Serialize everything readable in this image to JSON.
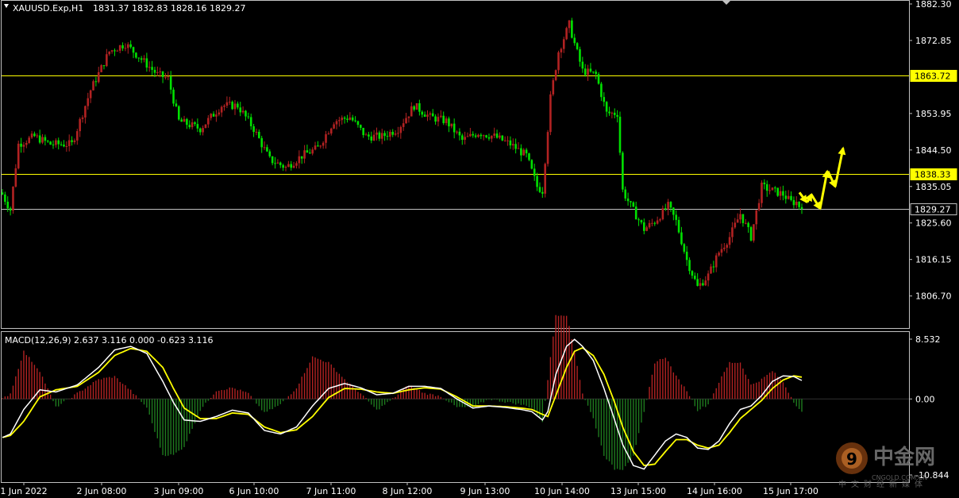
{
  "chart_data": [
    {
      "type": "candlestick",
      "symbol_header": "XAUUSD.Exp,H1",
      "ohlc_header": "1831.37 1832.83 1828.16 1829.27",
      "ylim": [
        1801.9,
        1882.3
      ],
      "y_ticks": [
        "1882.30",
        "1872.85",
        "1853.95",
        "1844.50",
        "1835.05",
        "1825.60",
        "1816.15",
        "1806.70"
      ],
      "x_ticks": [
        "1 Jun 2022",
        "2 Jun 08:00",
        "3 Jun 09:00",
        "6 Jun 10:00",
        "7 Jun 11:00",
        "8 Jun 12:00",
        "9 Jun 13:00",
        "10 Jun 14:00",
        "13 Jun 15:00",
        "14 Jun 16:00",
        "15 Jun 17:00"
      ],
      "bullish_color": "#b22222",
      "bearish_color": "#00e000",
      "horizontal_levels": [
        {
          "value": 1863.72,
          "label": "1863.72",
          "color": "#ffff00"
        },
        {
          "value": 1838.33,
          "label": "1838.33",
          "color": "#ffff00"
        },
        {
          "value": 1829.27,
          "label": "1829.27",
          "color": "#c0c0c0"
        }
      ],
      "price_path": [
        [
          0,
          1833
        ],
        [
          3,
          1829
        ],
        [
          6,
          1846
        ],
        [
          12,
          1848
        ],
        [
          18,
          1846
        ],
        [
          26,
          1846
        ],
        [
          33,
          1860
        ],
        [
          40,
          1870
        ],
        [
          46,
          1872
        ],
        [
          52,
          1868
        ],
        [
          58,
          1864
        ],
        [
          62,
          1863
        ],
        [
          66,
          1852
        ],
        [
          74,
          1850
        ],
        [
          82,
          1856
        ],
        [
          88,
          1856
        ],
        [
          94,
          1850
        ],
        [
          100,
          1842
        ],
        [
          106,
          1840
        ],
        [
          112,
          1843
        ],
        [
          118,
          1845
        ],
        [
          124,
          1852
        ],
        [
          130,
          1853
        ],
        [
          136,
          1848
        ],
        [
          142,
          1848
        ],
        [
          148,
          1850
        ],
        [
          154,
          1856
        ],
        [
          160,
          1853
        ],
        [
          166,
          1852
        ],
        [
          172,
          1847
        ],
        [
          178,
          1849
        ],
        [
          184,
          1848
        ],
        [
          190,
          1846
        ],
        [
          196,
          1843
        ],
        [
          200,
          1835
        ],
        [
          202,
          1834
        ],
        [
          205,
          1858
        ],
        [
          208,
          1870
        ],
        [
          212,
          1877
        ],
        [
          214,
          1872
        ],
        [
          217,
          1865
        ],
        [
          222,
          1864
        ],
        [
          226,
          1854
        ],
        [
          230,
          1854
        ],
        [
          232,
          1834
        ],
        [
          235,
          1830
        ],
        [
          240,
          1824
        ],
        [
          244,
          1826
        ],
        [
          249,
          1830
        ],
        [
          252,
          1826
        ],
        [
          256,
          1816
        ],
        [
          260,
          1809
        ],
        [
          264,
          1812
        ],
        [
          268,
          1818
        ],
        [
          272,
          1822
        ],
        [
          276,
          1828
        ],
        [
          280,
          1822
        ],
        [
          284,
          1835
        ],
        [
          288,
          1834
        ],
        [
          292,
          1833
        ],
        [
          295,
          1831
        ],
        [
          297,
          1831
        ],
        [
          299,
          1829
        ]
      ],
      "projection_arrows": [
        {
          "from": [
            1007,
            1833.5
          ],
          "to": [
            1016,
            1831.0
          ]
        },
        {
          "from": [
            1017,
            1831.0
          ],
          "to": [
            1022,
            1833.0
          ]
        },
        {
          "from": [
            1022,
            1833.0
          ],
          "to": [
            1033,
            1829.3
          ]
        },
        {
          "from": [
            1033,
            1829.3
          ],
          "to": [
            1042,
            1839.0
          ]
        },
        {
          "from": [
            1043,
            1839.0
          ],
          "to": [
            1052,
            1835.0
          ]
        },
        {
          "from": [
            1052,
            1835.0
          ],
          "to": [
            1062,
            1845.0
          ]
        }
      ],
      "arrow_color": "#ffff00"
    },
    {
      "type": "macd",
      "header": "MACD(12,26,9) 2.637 3.116 0.000 -0.623 3.116",
      "ylim": [
        -10.844,
        8.532
      ],
      "y_ticks": [
        "8.532",
        "0.00",
        "-10.844"
      ],
      "macd_color": "#ffffff",
      "signal_color": "#ffff00",
      "hist_pos_color": "#b22222",
      "hist_neg_color": "#1e7a1e",
      "macd_series": [
        [
          0,
          -5.5
        ],
        [
          3,
          -5.0
        ],
        [
          8,
          -1.5
        ],
        [
          14,
          1.3
        ],
        [
          20,
          1.0
        ],
        [
          28,
          2.0
        ],
        [
          36,
          4.5
        ],
        [
          42,
          7.0
        ],
        [
          48,
          7.5
        ],
        [
          54,
          6.5
        ],
        [
          60,
          2.5
        ],
        [
          64,
          -0.5
        ],
        [
          68,
          -3.0
        ],
        [
          74,
          -3.2
        ],
        [
          80,
          -2.5
        ],
        [
          86,
          -1.6
        ],
        [
          92,
          -2.0
        ],
        [
          98,
          -4.5
        ],
        [
          104,
          -5.0
        ],
        [
          110,
          -4.0
        ],
        [
          116,
          -1.0
        ],
        [
          122,
          1.5
        ],
        [
          128,
          2.2
        ],
        [
          134,
          1.6
        ],
        [
          140,
          0.6
        ],
        [
          146,
          0.8
        ],
        [
          152,
          1.8
        ],
        [
          158,
          1.8
        ],
        [
          164,
          1.5
        ],
        [
          170,
          0.0
        ],
        [
          176,
          -1.3
        ],
        [
          182,
          -1.0
        ],
        [
          188,
          -1.2
        ],
        [
          194,
          -1.5
        ],
        [
          198,
          -1.8
        ],
        [
          202,
          -3.0
        ],
        [
          204,
          -1.8
        ],
        [
          207,
          3.5
        ],
        [
          211,
          7.5
        ],
        [
          214,
          8.5
        ],
        [
          217,
          7.5
        ],
        [
          221,
          5.5
        ],
        [
          225,
          1.5
        ],
        [
          229,
          -3.0
        ],
        [
          232,
          -6.5
        ],
        [
          236,
          -9.5
        ],
        [
          240,
          -10.0
        ],
        [
          244,
          -8.0
        ],
        [
          248,
          -6.0
        ],
        [
          252,
          -5.0
        ],
        [
          256,
          -5.5
        ],
        [
          260,
          -7.0
        ],
        [
          264,
          -7.2
        ],
        [
          268,
          -6.0
        ],
        [
          272,
          -3.5
        ],
        [
          276,
          -1.5
        ],
        [
          280,
          -1.0
        ],
        [
          284,
          0.5
        ],
        [
          288,
          2.5
        ],
        [
          292,
          3.3
        ],
        [
          296,
          3.2
        ],
        [
          299,
          2.637
        ]
      ],
      "signal_series": [
        [
          0,
          -5.5
        ],
        [
          3,
          -5.2
        ],
        [
          8,
          -3.2
        ],
        [
          14,
          0.3
        ],
        [
          20,
          1.3
        ],
        [
          28,
          1.8
        ],
        [
          36,
          3.8
        ],
        [
          42,
          6.2
        ],
        [
          48,
          7.2
        ],
        [
          54,
          6.8
        ],
        [
          60,
          4.5
        ],
        [
          64,
          1.5
        ],
        [
          68,
          -1.3
        ],
        [
          74,
          -2.8
        ],
        [
          80,
          -2.8
        ],
        [
          86,
          -2.0
        ],
        [
          92,
          -2.2
        ],
        [
          98,
          -4.0
        ],
        [
          104,
          -4.8
        ],
        [
          110,
          -4.4
        ],
        [
          116,
          -2.5
        ],
        [
          122,
          0.2
        ],
        [
          128,
          1.5
        ],
        [
          134,
          1.4
        ],
        [
          140,
          1.0
        ],
        [
          146,
          0.8
        ],
        [
          152,
          1.3
        ],
        [
          158,
          1.6
        ],
        [
          164,
          1.4
        ],
        [
          170,
          0.3
        ],
        [
          176,
          -1.0
        ],
        [
          182,
          -1.0
        ],
        [
          188,
          -1.1
        ],
        [
          194,
          -1.3
        ],
        [
          198,
          -1.5
        ],
        [
          202,
          -2.2
        ],
        [
          204,
          -2.5
        ],
        [
          207,
          0.5
        ],
        [
          211,
          4.5
        ],
        [
          214,
          6.8
        ],
        [
          217,
          7.3
        ],
        [
          221,
          6.2
        ],
        [
          225,
          3.5
        ],
        [
          229,
          -0.5
        ],
        [
          232,
          -4.0
        ],
        [
          236,
          -7.5
        ],
        [
          240,
          -9.5
        ],
        [
          244,
          -9.3
        ],
        [
          248,
          -7.5
        ],
        [
          252,
          -5.8
        ],
        [
          256,
          -5.8
        ],
        [
          260,
          -6.6
        ],
        [
          264,
          -7.0
        ],
        [
          268,
          -6.6
        ],
        [
          272,
          -4.8
        ],
        [
          276,
          -2.8
        ],
        [
          280,
          -1.5
        ],
        [
          284,
          -0.2
        ],
        [
          288,
          1.5
        ],
        [
          292,
          2.7
        ],
        [
          296,
          3.3
        ],
        [
          299,
          3.116
        ]
      ]
    }
  ],
  "watermark": {
    "logo_text": "中金网",
    "sub_text": "中文财经新媒体",
    "url_text": "CNGOLD.COM.CN"
  },
  "header_icon": "dropdown-triangle-icon",
  "scroll_marker_icon": "scroll-marker-icon"
}
